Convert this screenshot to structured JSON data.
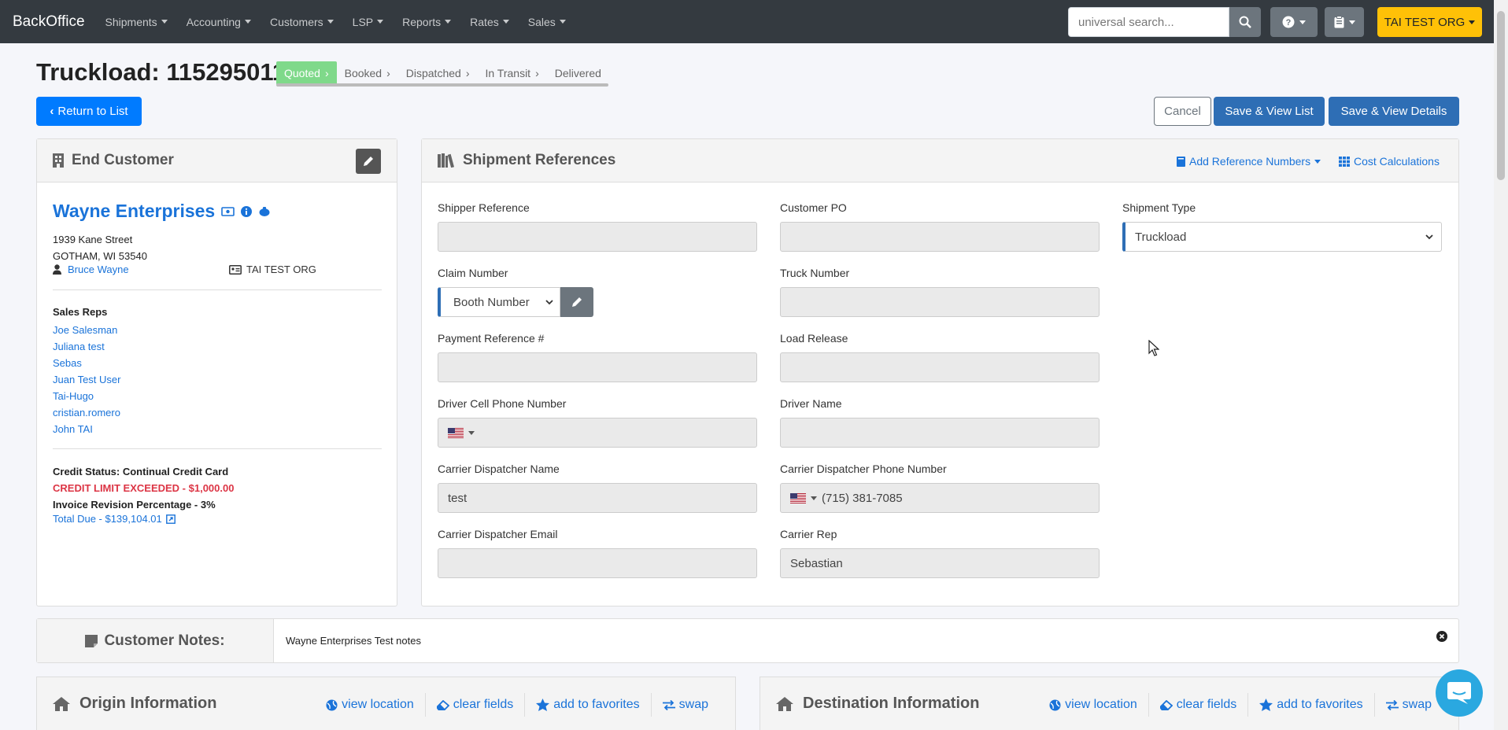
{
  "navbar": {
    "brand": "BackOffice",
    "menu": [
      "Shipments",
      "Accounting",
      "Customers",
      "LSP",
      "Reports",
      "Rates",
      "Sales"
    ],
    "search_placeholder": "universal search...",
    "org_label": "TAI TEST ORG",
    "icons": [
      "search-icon",
      "help-icon",
      "clipboard-icon"
    ]
  },
  "page": {
    "title": "Truckload: 115295011",
    "steps": [
      "Quoted",
      "Booked",
      "Dispatched",
      "In Transit",
      "Delivered"
    ],
    "active_step": "Quoted",
    "return_label": "Return to List",
    "cancel_label": "Cancel",
    "save_list_label": "Save & View List",
    "save_details_label": "Save & View Details"
  },
  "end_customer": {
    "heading": "End Customer",
    "name": "Wayne Enterprises",
    "address1": "1939 Kane Street",
    "address2": "GOTHAM, WI 53540",
    "contact": "Bruce Wayne",
    "org": "TAI TEST ORG",
    "sales_reps_label": "Sales Reps",
    "sales_reps": [
      "Joe Salesman",
      "Juliana test",
      "Sebas",
      "Juan Test User",
      "Tai-Hugo",
      "cristian.romero",
      "John TAI"
    ],
    "credit_status": "Credit Status: Continual Credit Card",
    "credit_limit": "CREDIT LIMIT EXCEEDED - $1,000.00",
    "invoice_revision": "Invoice Revision Percentage - 3%",
    "total_due": "Total Due - $139,104.01"
  },
  "references": {
    "heading": "Shipment References",
    "add_ref_label": "Add Reference Numbers",
    "cost_calc_label": "Cost Calculations",
    "fields": {
      "shipper_reference": {
        "label": "Shipper Reference",
        "value": ""
      },
      "customer_po": {
        "label": "Customer PO",
        "value": ""
      },
      "shipment_type": {
        "label": "Shipment Type",
        "value": "Truckload"
      },
      "claim_number": {
        "label": "Claim Number",
        "value": "Booth Number"
      },
      "truck_number": {
        "label": "Truck Number",
        "value": ""
      },
      "payment_reference": {
        "label": "Payment Reference #",
        "value": ""
      },
      "load_release": {
        "label": "Load Release",
        "value": ""
      },
      "driver_cell": {
        "label": "Driver Cell Phone Number",
        "value": ""
      },
      "driver_name": {
        "label": "Driver Name",
        "value": ""
      },
      "dispatcher_name": {
        "label": "Carrier Dispatcher Name",
        "value": "test"
      },
      "dispatcher_phone": {
        "label": "Carrier Dispatcher Phone Number",
        "value": "(715) 381-7085"
      },
      "dispatcher_email": {
        "label": "Carrier Dispatcher Email",
        "value": ""
      },
      "carrier_rep": {
        "label": "Carrier Rep",
        "value": "Sebastian"
      }
    }
  },
  "notes": {
    "label": "Customer Notes:",
    "text": "Wayne Enterprises Test notes"
  },
  "origin": {
    "heading": "Origin Information",
    "actions": [
      "view location",
      "clear fields",
      "add to favorites",
      "swap"
    ]
  },
  "destination": {
    "heading": "Destination Information",
    "actions": [
      "view location",
      "clear fields",
      "add to favorites",
      "swap"
    ]
  },
  "colors": {
    "navbar": "#343a40",
    "primary": "#007bff",
    "accent": "#ffc107",
    "danger": "#dc3545",
    "link": "#1a73d9",
    "step_active": "#7fd98a"
  }
}
